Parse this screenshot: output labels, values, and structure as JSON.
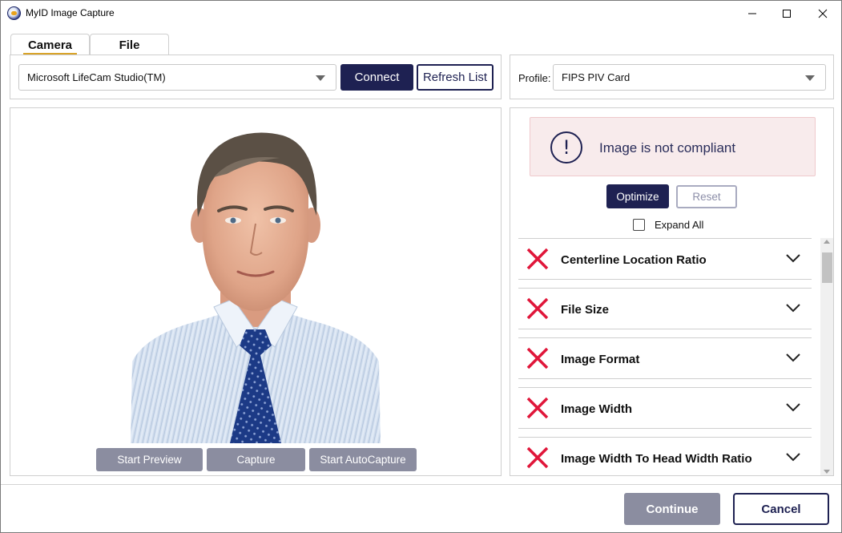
{
  "window": {
    "title": "MyID Image Capture",
    "icon": "myid-app-icon"
  },
  "tabs": [
    {
      "label": "Camera",
      "active": true
    },
    {
      "label": "File",
      "active": false
    }
  ],
  "camera": {
    "selected_device": "Microsoft LifeCam Studio(TM)",
    "connect_label": "Connect",
    "refresh_label": "Refresh List"
  },
  "profile": {
    "label": "Profile:",
    "selected": "FIPS PIV Card"
  },
  "capture_actions": {
    "start_preview": "Start Preview",
    "capture": "Capture",
    "start_autocapture": "Start AutoCapture"
  },
  "compliance": {
    "status_text": "Image is not compliant",
    "status_icon": "exclamation-circle-icon",
    "optimize_label": "Optimize",
    "reset_label": "Reset",
    "expand_all_label": "Expand All",
    "expand_all_checked": false,
    "rules": [
      {
        "label": "Centerline Location Ratio",
        "status": "fail"
      },
      {
        "label": "File Size",
        "status": "fail"
      },
      {
        "label": "Image Format",
        "status": "fail"
      },
      {
        "label": "Image Width",
        "status": "fail"
      },
      {
        "label": "Image Width To Head Width Ratio",
        "status": "fail"
      }
    ]
  },
  "footer": {
    "continue_label": "Continue",
    "cancel_label": "Cancel"
  },
  "colors": {
    "accent_dark": "#1e2152",
    "disabled_button": "#8b8da0",
    "fail_red": "#e0163a",
    "alert_background": "#f8ebec",
    "tab_underline": "#d9a429"
  }
}
